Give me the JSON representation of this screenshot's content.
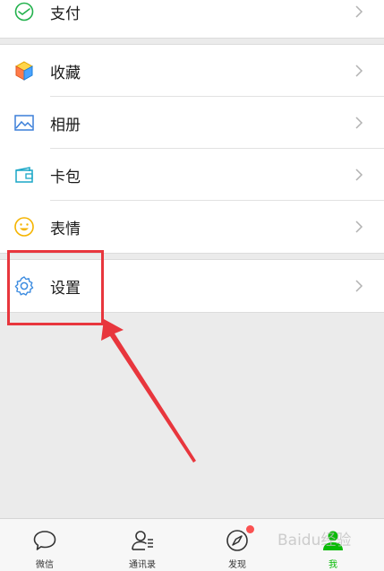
{
  "menu": {
    "pay": {
      "label": "支付",
      "icon": "wallet-icon"
    },
    "favorites": {
      "label": "收藏",
      "icon": "cube-icon"
    },
    "album": {
      "label": "相册",
      "icon": "picture-icon"
    },
    "cards": {
      "label": "卡包",
      "icon": "card-icon"
    },
    "stickers": {
      "label": "表情",
      "icon": "smiley-icon"
    },
    "settings": {
      "label": "设置",
      "icon": "gear-icon"
    }
  },
  "tabbar": {
    "tabs": [
      {
        "label": "微信",
        "icon": "chat-bubble-icon"
      },
      {
        "label": "通讯录",
        "icon": "contacts-icon"
      },
      {
        "label": "发现",
        "icon": "compass-icon",
        "badge": true
      },
      {
        "label": "我",
        "icon": "me-icon",
        "active": true
      }
    ]
  },
  "colors": {
    "accent_green": "#09bb07",
    "annotation_red": "#e8363d",
    "badge_red": "#fa5151"
  },
  "watermark": {
    "text": "Baidu经验"
  }
}
